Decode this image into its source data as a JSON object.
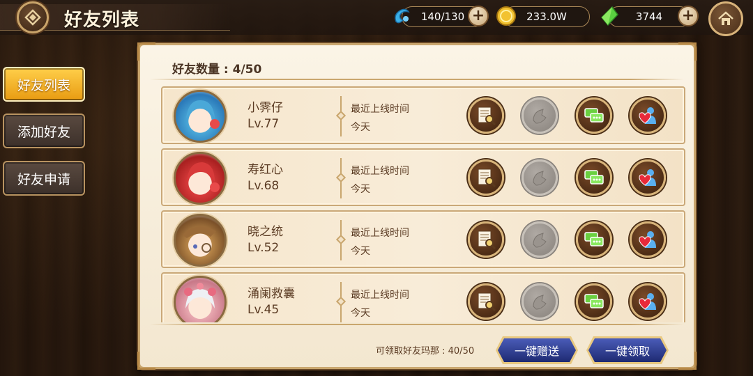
{
  "header": {
    "title": "好友列表",
    "resources": [
      {
        "icon": "stamina-icon",
        "value": "140/130"
      },
      {
        "icon": "gold-coin-icon",
        "value": "233.0W"
      },
      {
        "icon": "green-crystal-icon",
        "value": "3744"
      }
    ]
  },
  "tabs": [
    {
      "label": "好友列表",
      "active": true
    },
    {
      "label": "添加好友",
      "active": false
    },
    {
      "label": "好友申请",
      "active": false
    }
  ],
  "panel": {
    "count_label": "好友数量 : 4/50",
    "friends": [
      {
        "name": "小霁仔",
        "level": "Lv.77",
        "online_label": "最近上线时间",
        "online_value": "今天",
        "avatar_color": "#4aa8d8"
      },
      {
        "name": "寿红心",
        "level": "Lv.68",
        "online_label": "最近上线时间",
        "online_value": "今天",
        "avatar_color": "#d83a3a"
      },
      {
        "name": "晓之统",
        "level": "Lv.52",
        "online_label": "最近上线时间",
        "online_value": "今天",
        "avatar_color": "#b88648"
      },
      {
        "name": "涌阑救囊",
        "level": "Lv.45",
        "online_label": "最近上线时间",
        "online_value": "今天",
        "avatar_color": "#e8a8b0"
      }
    ],
    "footer_text": "可领取好友玛那 : 40/50",
    "buttons": {
      "send_all": "一键赠送",
      "claim_all": "一键领取"
    }
  },
  "colors": {
    "tab_active": "#f0a820",
    "panel_bg": "#f8efe0",
    "action_button": "#5a321a",
    "footer_button": "#2a3a8a"
  }
}
